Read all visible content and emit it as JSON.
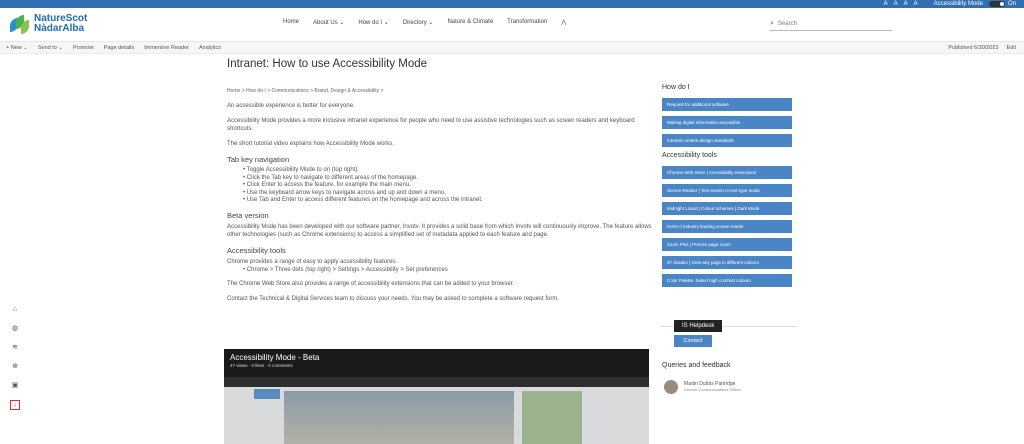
{
  "topbar": {
    "font_sizes": [
      "A",
      "A",
      "A",
      "A"
    ],
    "accessibility_label": "Accessibility Mode",
    "toggle_state": "On"
  },
  "header": {
    "logo_line1": "NatureScot",
    "logo_line2": "NàdarAlba",
    "nav": [
      "Home",
      "About Us ⌄",
      "How do I ⌄",
      "Directory ⌄",
      "Nature & Climate",
      "Transformation",
      "⋀"
    ],
    "search_placeholder": "Search"
  },
  "commandbar": {
    "items": [
      "+ New ⌄",
      "Send to ⌄",
      "Promote",
      "Page details",
      "Immersive Reader",
      "Analytics"
    ],
    "published": "Published 6/30/2023",
    "edit": "Edit"
  },
  "main": {
    "title": "Intranet: How to use Accessibility Mode",
    "breadcrumb": "Home  >  How do I  >  Communications  >  Brand, Design & Accessibility  >",
    "intro": "An accessible experience is better for everyone.",
    "p1": "Accessibility Mode provides a more inclusive intranet experience for people who need to use assistive technologies such as screen readers and keyboard shortcuts.",
    "p2": "The short tutorial video explains how Accessibility Mode works.",
    "h_tab": "Tab key navigation",
    "tab_list": [
      "Toggle Accessibility Mode to on (top right).",
      "Click the Tab key to navigate to different areas of the homepage.",
      "Click Enter to access the feature, for example the main menu.",
      "Use the keyboard arrow keys to navigate across and up and down a menu.",
      "Use Tab and Enter to access different features on the homepage and across the intranet."
    ],
    "h_beta": "Beta version",
    "beta_text": "Accessibility Mode has been developed with our software partner, Invotv. It provides a solid base from which Invotv will continuously improve. The feature allows other technologies (such as Chrome extensions) to access a simplified set of metadata applied to each feature and page.",
    "h_tools": "Accessibility tools",
    "tools_text": "Chrome provides a range of easy to apply accessibility features.",
    "tools_list": [
      "Chrome > Three dots (top right) > Settings > Accessibility > Set preferences"
    ],
    "store_text": "The Chrome Web Store also provides a range of accessibility extensions that can be added to your browser.",
    "contact_text": "Contact the Technical & Digital Services team to discuss your needs. You may be asked to complete a software request form.",
    "video_title": "Accessibility Mode - Beta",
    "video_meta": "47 views · 0 likes · 0 comments"
  },
  "side": {
    "howdoi_heading": "How do I",
    "howdoi_links": [
      "Request for additional software",
      "Making digital information accessible",
      "Intranet content design standards"
    ],
    "tools_heading": "Accessibility tools",
    "tools_links": [
      "Chrome Web Store | Accessibility extensions",
      "Screen Reader | Text screen to text-type mode",
      "Midnight Lizard | Colour schemes | Dark Mode",
      "NVDA | Industry leading screen reader",
      "Zoom Plus | Precise page zoom",
      "37 shades | View any page in different colours",
      "Color Palette: Select high contrast colours"
    ],
    "helpdesk": "IS Helpdesk",
    "contact": "Contact",
    "queries_heading": "Queries and feedback",
    "person_name": "Martin Dubbs Partridge",
    "person_role": "Internal Communications Officer"
  },
  "leftbar_icons": [
    "home-icon",
    "globe-icon",
    "feed-icon",
    "sites-icon",
    "files-icon",
    "accessibility-icon"
  ]
}
